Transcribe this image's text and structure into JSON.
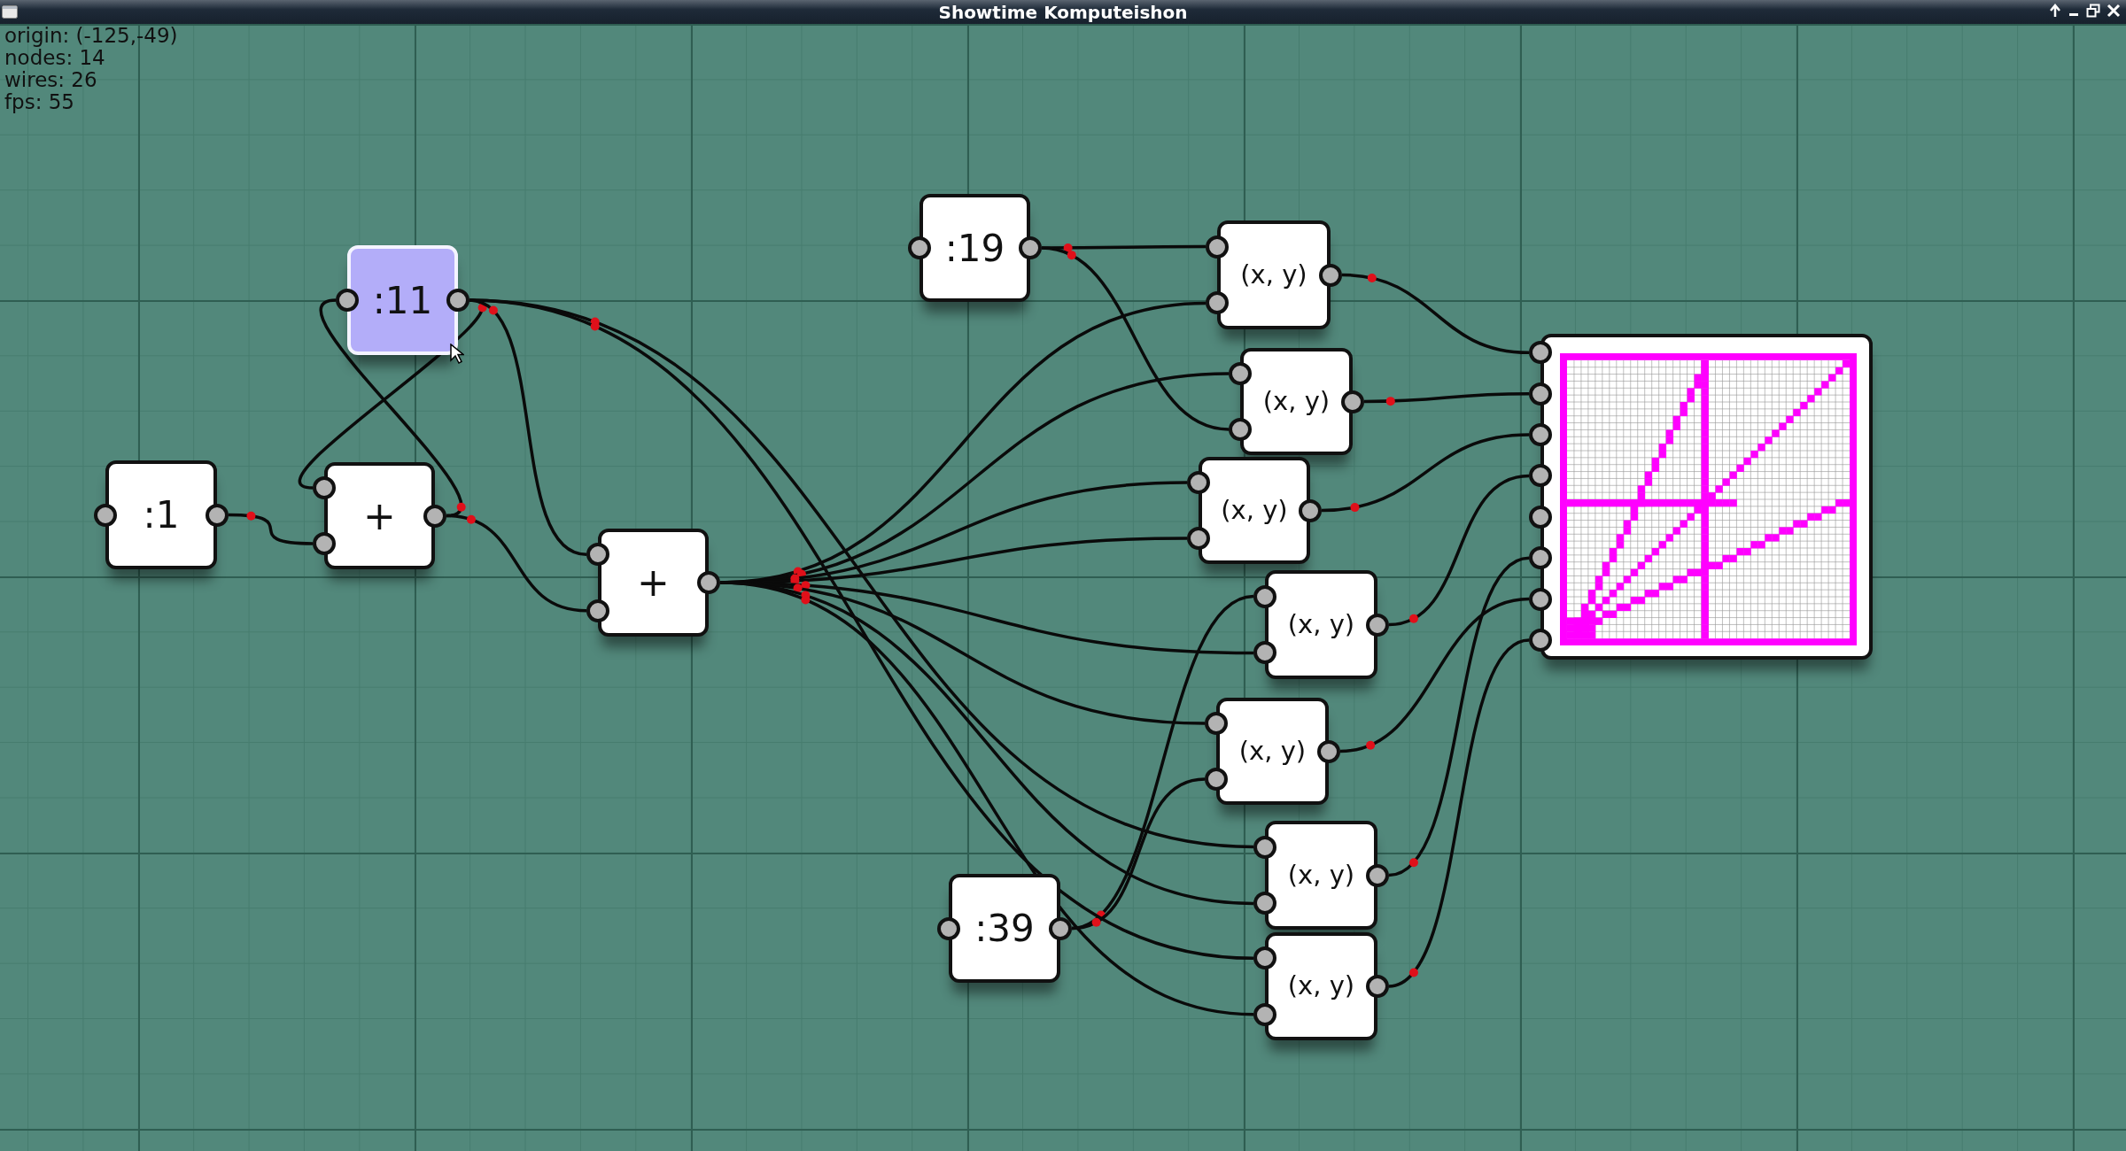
{
  "window": {
    "title": "Showtime Komputeishon"
  },
  "info": [
    "origin: (-125,-49)",
    "nodes: 14",
    "wires: 26",
    "fps: 55"
  ],
  "nodes": [
    {
      "kind": "value",
      "label": ":11",
      "selected": true
    },
    {
      "kind": "value",
      "label": ":1",
      "selected": false
    },
    {
      "kind": "op",
      "label": "+",
      "selected": false
    },
    {
      "kind": "op",
      "label": "+",
      "selected": false
    },
    {
      "kind": "value",
      "label": ":19",
      "selected": false
    },
    {
      "kind": "op",
      "label": "(x, y)",
      "selected": false
    },
    {
      "kind": "op",
      "label": "(x, y)",
      "selected": false
    },
    {
      "kind": "op",
      "label": "(x, y)",
      "selected": false
    },
    {
      "kind": "op",
      "label": "(x, y)",
      "selected": false
    },
    {
      "kind": "op",
      "label": "(x, y)",
      "selected": false
    },
    {
      "kind": "op",
      "label": "(x, y)",
      "selected": false
    },
    {
      "kind": "op",
      "label": "(x, y)",
      "selected": false
    },
    {
      "kind": "value",
      "label": ":39",
      "selected": false
    },
    {
      "kind": "plot",
      "selected": false
    }
  ]
}
